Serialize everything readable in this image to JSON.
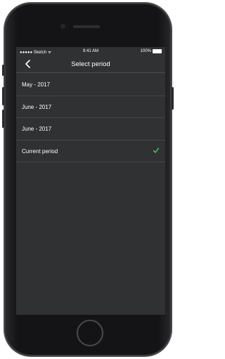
{
  "status_bar": {
    "carrier": "●●●●● Sketch ᯤ",
    "time": "9:41 AM",
    "battery_percent": "100%"
  },
  "nav": {
    "back_icon": "chevron-left-icon",
    "title": "Select period"
  },
  "periods": [
    {
      "label": "May - 2017",
      "selected": false
    },
    {
      "label": "June - 2017",
      "selected": false
    },
    {
      "label": "June - 2017",
      "selected": false
    },
    {
      "label": "Current period",
      "selected": true
    }
  ],
  "colors": {
    "background": "#2f3133",
    "separator": "#45474a",
    "text": "#ffffff",
    "checkmark": "#4cd964"
  }
}
